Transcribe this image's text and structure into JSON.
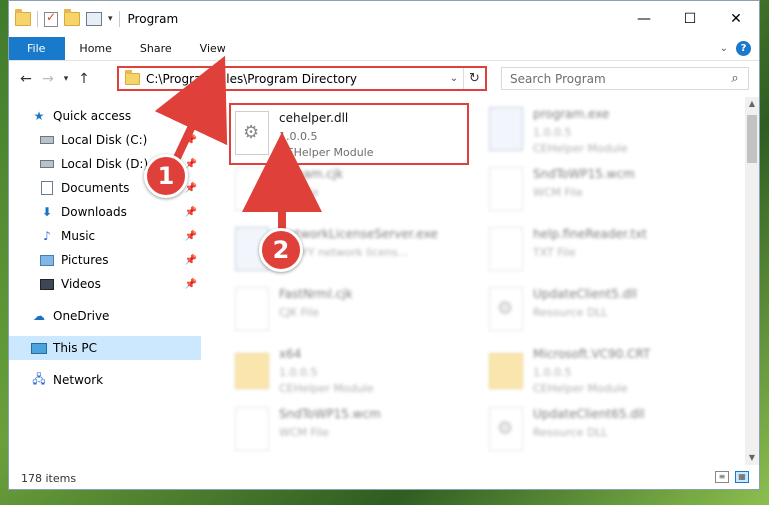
{
  "window": {
    "title": "Program",
    "controls": [
      "—",
      "☐",
      "✕"
    ]
  },
  "ribbon": {
    "tabs": [
      "File",
      "Home",
      "Share",
      "View"
    ]
  },
  "address": {
    "path": "C:\\Program Files\\Program Directory"
  },
  "search": {
    "placeholder": "Search Program"
  },
  "sidebar": {
    "items": [
      {
        "label": "Quick access",
        "icon": "star-icon"
      },
      {
        "label": "Local Disk (C:)",
        "icon": "drive-icon",
        "pinned": true
      },
      {
        "label": "Local Disk (D:)",
        "icon": "drive-icon",
        "pinned": true
      },
      {
        "label": "Documents",
        "icon": "documents-icon",
        "pinned": true
      },
      {
        "label": "Downloads",
        "icon": "downloads-icon",
        "pinned": true
      },
      {
        "label": "Music",
        "icon": "music-icon",
        "pinned": true
      },
      {
        "label": "Pictures",
        "icon": "pictures-icon",
        "pinned": true
      },
      {
        "label": "Videos",
        "icon": "videos-icon",
        "pinned": true
      },
      {
        "label": "OneDrive",
        "icon": "cloud-icon"
      },
      {
        "label": "This PC",
        "icon": "pc-icon",
        "selected": true
      },
      {
        "label": "Network",
        "icon": "network-icon"
      }
    ]
  },
  "files": [
    {
      "name": "cehelper.dll",
      "line2": "1.0.0.5",
      "line3": "CEHelper Module",
      "type": "dll",
      "highlighted": true
    },
    {
      "name": "program.exe",
      "line2": "1.0.0.5",
      "line3": "CEHelper Module",
      "type": "exe"
    },
    {
      "name": "Stream.cjk",
      "line2": "CJK File",
      "line3": "",
      "type": "file"
    },
    {
      "name": "SndToWP15.wcm",
      "line2": "WCM File",
      "line3": "",
      "type": "file"
    },
    {
      "name": "NetworkLicenseServer.exe",
      "line2": "ABBYY network licens...",
      "line3": "",
      "type": "exe"
    },
    {
      "name": "help.fineReader.txt",
      "line2": "TXT File",
      "line3": "",
      "type": "file"
    },
    {
      "name": "FastNrml.cjk",
      "line2": "CJK File",
      "line3": "",
      "type": "file"
    },
    {
      "name": "UpdateClient5.dll",
      "line2": "Resource DLL",
      "line3": "",
      "type": "dll"
    },
    {
      "name": "x64",
      "line2": "1.0.0.5",
      "line3": "CEHelper Module",
      "type": "folder"
    },
    {
      "name": "Microsoft.VC90.CRT",
      "line2": "1.0.0.5",
      "line3": "CEHelper Module",
      "type": "folder"
    },
    {
      "name": "SndToWP15.wcm",
      "line2": "WCM File",
      "line3": "",
      "type": "file"
    },
    {
      "name": "UpdateClient65.dll",
      "line2": "Resource DLL",
      "line3": "",
      "type": "dll"
    }
  ],
  "status": {
    "count": "178 items"
  },
  "annotations": {
    "badge1": "1",
    "badge2": "2"
  },
  "colors": {
    "accent": "#1979ca",
    "annotation": "#e0403a",
    "selection": "#cce8ff"
  }
}
